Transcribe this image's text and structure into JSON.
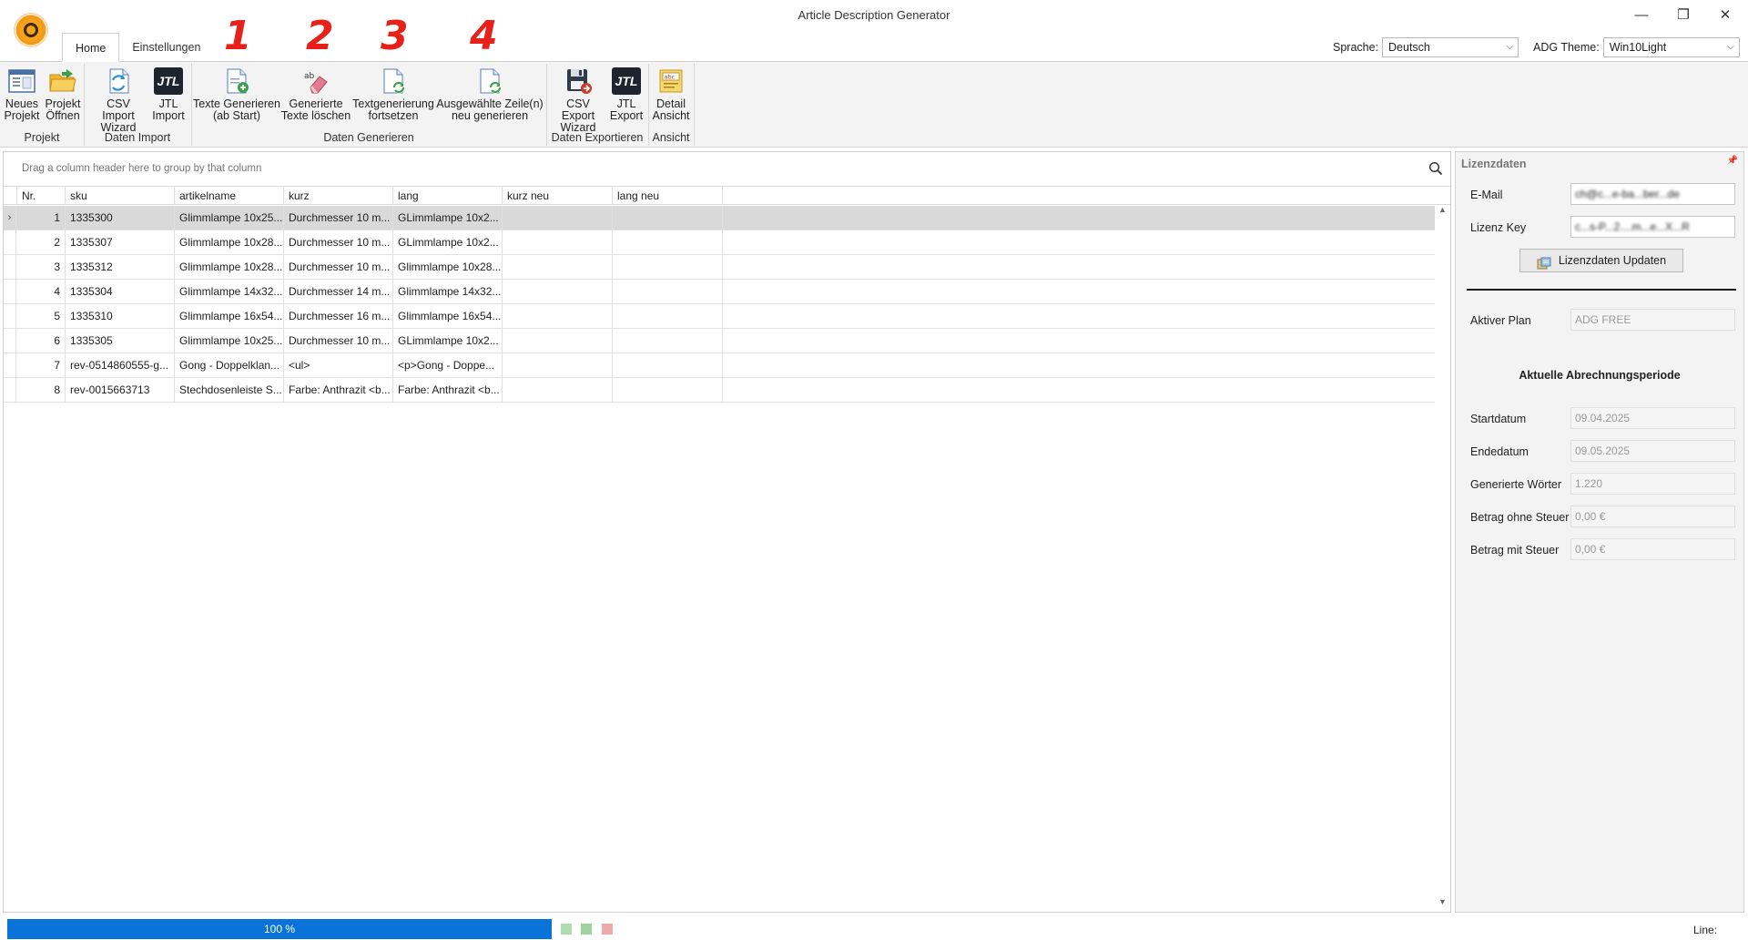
{
  "window": {
    "title": "Article Description Generator"
  },
  "tabs": [
    "Home",
    "Einstellungen"
  ],
  "annotations": [
    "1",
    "2",
    "3",
    "4"
  ],
  "top_right": {
    "language_label": "Sprache:",
    "language_value": "Deutsch",
    "theme_label": "ADG Theme:",
    "theme_value": "Win10Light"
  },
  "ribbon": {
    "buttons": {
      "new_project": [
        "Neues",
        "Projekt"
      ],
      "open_project": [
        "Projekt",
        "Öffnen"
      ],
      "csv_import": [
        "CSV Import",
        "Wizard"
      ],
      "jtl_import": [
        "JTL",
        "Import"
      ],
      "generate": [
        "Texte Generieren",
        "(ab Start)"
      ],
      "delete_generated": [
        "Generierte",
        "Texte löschen"
      ],
      "continue_generation": [
        "Textgenerierung",
        "fortsetzen"
      ],
      "regenerate_selected": [
        "Ausgewählte Zeile(n)",
        "neu generieren"
      ],
      "csv_export": [
        "CSV Export",
        "Wizard"
      ],
      "jtl_export": [
        "JTL",
        "Export"
      ],
      "detail_view": [
        "Detail",
        "Ansicht"
      ]
    },
    "groups": {
      "projekt": "Projekt",
      "daten_import": "Daten Import",
      "daten_generieren": "Daten Generieren",
      "daten_exportieren": "Daten Exportieren",
      "ansicht": "Ansicht"
    },
    "jtl_logo_text": "JTL"
  },
  "grid": {
    "group_hint": "Drag a column header here to group by that column",
    "columns": [
      "Nr.",
      "sku",
      "artikelname",
      "kurz",
      "lang",
      "kurz neu",
      "lang neu"
    ],
    "rows": [
      [
        "1",
        "1335300",
        "Glimmlampe 10x25...",
        "Durchmesser 10 m...",
        "GLimmlampe 10x2...",
        "",
        ""
      ],
      [
        "2",
        "1335307",
        "Glimmlampe 10x28...",
        "Durchmesser 10 m...",
        "GLimmlampe 10x2...",
        "",
        ""
      ],
      [
        "3",
        "1335312",
        "Glimmlampe 10x28...",
        "Durchmesser 10 m...",
        "Glimmlampe 10x28...",
        "",
        ""
      ],
      [
        "4",
        "1335304",
        "Glimmlampe 14x32...",
        "Durchmesser 14 m...",
        "Glimmlampe 14x32...",
        "",
        ""
      ],
      [
        "5",
        "1335310",
        "Glimmlampe 16x54...",
        "Durchmesser 16 m...",
        "Glimmlampe 16x54...",
        "",
        ""
      ],
      [
        "6",
        "1335305",
        "Glimmlampe 10x25...",
        "Durchmesser 10 m...",
        "GLimmlampe 10x2...",
        "",
        ""
      ],
      [
        "7",
        "rev-0514860555-g...",
        "Gong - Doppelklan...",
        "<ul>",
        "<p>Gong - Doppe...",
        "",
        ""
      ],
      [
        "8",
        "rev-0015663713",
        "Stechdosenleiste S...",
        "Farbe: Anthrazit <b...",
        "Farbe: Anthrazit <b...",
        "",
        ""
      ]
    ],
    "selected_row": 0
  },
  "license": {
    "panel_title": "Lizenzdaten",
    "email_label": "E-Mail",
    "email_value": "ch@c...e-ba...ber...de",
    "key_label": "Lizenz Key",
    "key_value": "c...s-P...2....m...e...X...R",
    "update_button": "Lizenzdaten Updaten",
    "plan_label": "Aktiver Plan",
    "plan_value": "ADG FREE",
    "period_heading": "Aktuelle Abrechnungsperiode",
    "start_label": "Startdatum",
    "start_value": "09.04.2025",
    "end_label": "Endedatum",
    "end_value": "09.05.2025",
    "words_label": "Generierte Wörter",
    "words_value": "1.220",
    "net_label": "Betrag ohne Steuer",
    "net_value": "0,00 €",
    "gross_label": "Betrag mit Steuer",
    "gross_value": "0,00 €"
  },
  "status": {
    "progress_percent": 100,
    "progress_text": "100 %",
    "line_label": "Line:"
  },
  "colors": {
    "accent": "#0a73d9",
    "annotation": "#e8201a",
    "ribbon_bg": "#f3f3f3",
    "selected_row": "#d9d9d9"
  }
}
